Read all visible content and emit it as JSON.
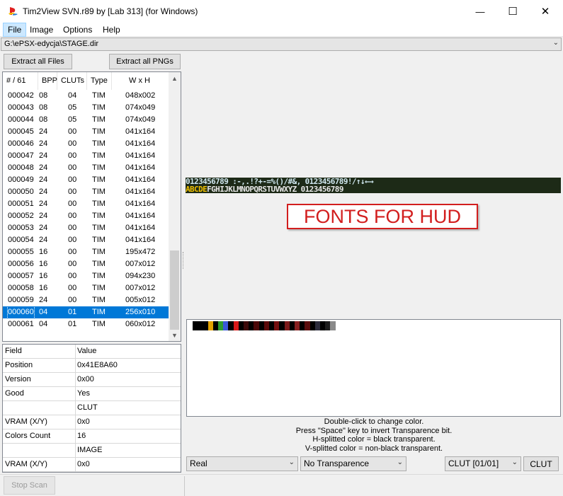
{
  "window": {
    "title": "Tim2View SVN.r89 by [Lab 313] (for Windows)",
    "minimize_glyph": "—",
    "maximize_glyph": "☐",
    "close_glyph": "✕"
  },
  "menu": [
    "File",
    "Image",
    "Options",
    "Help"
  ],
  "path": {
    "value": "G:\\ePSX-edycja\\STAGE.dir"
  },
  "buttons": {
    "extract_files": "Extract all Files",
    "extract_pngs": "Extract all PNGs",
    "stop_scan": "Stop Scan",
    "clut": "CLUT"
  },
  "filelist": {
    "headers": [
      "# / 61",
      "BPP",
      "CLUTs",
      "Type",
      "W x H"
    ],
    "rows": [
      [
        "000042",
        "08",
        "04",
        "TIM",
        "048x002"
      ],
      [
        "000043",
        "08",
        "05",
        "TIM",
        "074x049"
      ],
      [
        "000044",
        "08",
        "05",
        "TIM",
        "074x049"
      ],
      [
        "000045",
        "24",
        "00",
        "TIM",
        "041x164"
      ],
      [
        "000046",
        "24",
        "00",
        "TIM",
        "041x164"
      ],
      [
        "000047",
        "24",
        "00",
        "TIM",
        "041x164"
      ],
      [
        "000048",
        "24",
        "00",
        "TIM",
        "041x164"
      ],
      [
        "000049",
        "24",
        "00",
        "TIM",
        "041x164"
      ],
      [
        "000050",
        "24",
        "00",
        "TIM",
        "041x164"
      ],
      [
        "000051",
        "24",
        "00",
        "TIM",
        "041x164"
      ],
      [
        "000052",
        "24",
        "00",
        "TIM",
        "041x164"
      ],
      [
        "000053",
        "24",
        "00",
        "TIM",
        "041x164"
      ],
      [
        "000054",
        "24",
        "00",
        "TIM",
        "041x164"
      ],
      [
        "000055",
        "16",
        "00",
        "TIM",
        "195x472"
      ],
      [
        "000056",
        "16",
        "00",
        "TIM",
        "007x012"
      ],
      [
        "000057",
        "16",
        "00",
        "TIM",
        "094x230"
      ],
      [
        "000058",
        "16",
        "00",
        "TIM",
        "007x012"
      ],
      [
        "000059",
        "24",
        "00",
        "TIM",
        "005x012"
      ],
      [
        "000060",
        "04",
        "01",
        "TIM",
        "256x010"
      ],
      [
        "000061",
        "04",
        "01",
        "TIM",
        "060x012"
      ]
    ],
    "selected_id": "000060"
  },
  "props": {
    "header": {
      "field": "Field",
      "value": "Value"
    },
    "rows": [
      {
        "field": "Position",
        "value": "0x41E8A60"
      },
      {
        "field": "Version",
        "value": "0x00"
      },
      {
        "field": "Good",
        "value": "Yes"
      },
      {
        "field": "",
        "value": "CLUT"
      },
      {
        "field": "VRAM (X/Y)",
        "value": "0x0"
      },
      {
        "field": "Colors Count",
        "value": "16"
      },
      {
        "field": "",
        "value": "IMAGE"
      },
      {
        "field": "VRAM (X/Y)",
        "value": "0x0"
      }
    ]
  },
  "preview": {
    "font_line1": "0123456789 :-,.!?+-=%()/#&, 0123456789!/↑↓←→",
    "font_line2_accent": "ABCDE",
    "font_line2_rest": "FGHIJKLMNOPQRSTUVWXYZ",
    "font_line2_tail": " 0123456789",
    "annotation": "FONTS FOR HUD"
  },
  "palette": {
    "colors": [
      "#000000",
      "#000000",
      "#000000",
      "#e2a200",
      "#000000",
      "#2e9b2e",
      "#3a58d8",
      "#000000",
      "#d81818",
      "#000000",
      "#3c0a0a",
      "#000000",
      "#4a0808",
      "#000000",
      "#5a0a0a",
      "#000000",
      "#740f0f",
      "#000000",
      "#7a1a1a",
      "#000000",
      "#862020",
      "#000000",
      "#5a0e0e",
      "#000000",
      "#2c2c3c",
      "#000000",
      "#1c1c1c",
      "#8a8a8a"
    ]
  },
  "info": {
    "line1": "Double-click to change color.",
    "line2": "Press \"Space\" key to invert Transparence bit.",
    "line3": "H-splitted color = black transparent.",
    "line4": "V-splitted color = non-black transparent."
  },
  "combos": {
    "render_mode": "Real",
    "transparence": "No Transparence",
    "clut_select": "CLUT [01/01]"
  }
}
